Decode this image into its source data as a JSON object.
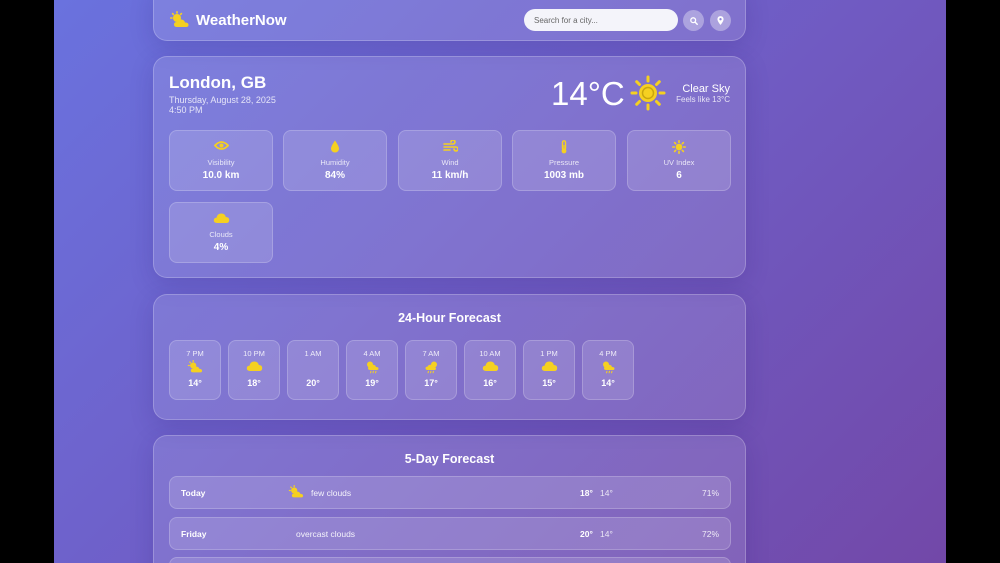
{
  "app": {
    "title": "WeatherNow"
  },
  "search": {
    "placeholder": "Search for a city..."
  },
  "current": {
    "city": "London, GB",
    "date": "Thursday, August 28, 2025",
    "time": "4:50 PM",
    "temperature": "14°C",
    "condition": "Clear Sky",
    "feels_like": "Feels like 13°C",
    "icon": "sun-icon"
  },
  "stats": [
    {
      "label": "Visibility",
      "value": "10.0 km",
      "icon": "eye-icon"
    },
    {
      "label": "Humidity",
      "value": "84%",
      "icon": "droplet-icon"
    },
    {
      "label": "Wind",
      "value": "11 km/h",
      "icon": "wind-icon"
    },
    {
      "label": "Pressure",
      "value": "1003 mb",
      "icon": "thermometer-icon"
    },
    {
      "label": "UV Index",
      "value": "6",
      "icon": "sun-icon"
    },
    {
      "label": "Clouds",
      "value": "4%",
      "icon": "cloud-icon"
    }
  ],
  "hourly": {
    "title": "24-Hour Forecast",
    "items": [
      {
        "time": "7 PM",
        "temp": "14°",
        "icon": "partly-cloudy-icon"
      },
      {
        "time": "10 PM",
        "temp": "18°",
        "icon": "cloud-icon"
      },
      {
        "time": "1 AM",
        "temp": "20°",
        "icon": ""
      },
      {
        "time": "4 AM",
        "temp": "19°",
        "icon": "sun-rain-icon"
      },
      {
        "time": "7 AM",
        "temp": "17°",
        "icon": "sun-rain-icon"
      },
      {
        "time": "10 AM",
        "temp": "16°",
        "icon": "cloud-icon"
      },
      {
        "time": "1 PM",
        "temp": "15°",
        "icon": "cloud-icon"
      },
      {
        "time": "4 PM",
        "temp": "14°",
        "icon": "sun-rain-icon"
      }
    ]
  },
  "daily": {
    "title": "5-Day Forecast",
    "items": [
      {
        "day": "Today",
        "description": "few clouds",
        "high": "18°",
        "low": "14°",
        "humidity": "71%",
        "icon": "partly-cloudy-icon"
      },
      {
        "day": "Friday",
        "description": "overcast clouds",
        "high": "20°",
        "low": "14°",
        "humidity": "72%",
        "icon": ""
      }
    ]
  },
  "colors": {
    "accent": "#f5d021",
    "background_start": "#6a72de",
    "background_end": "#7248a8"
  }
}
